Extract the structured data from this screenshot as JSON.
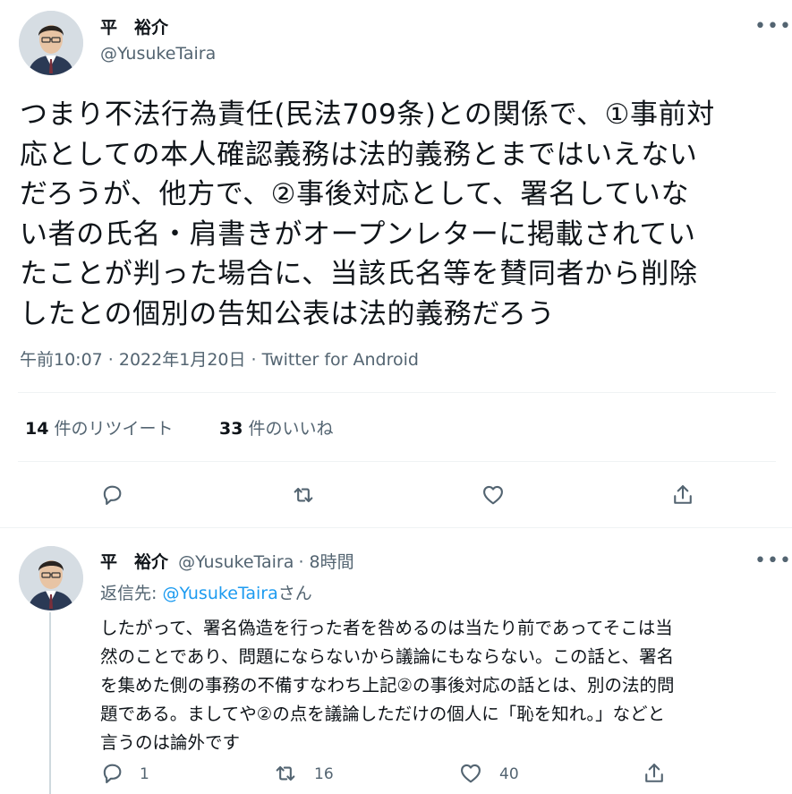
{
  "tweet": {
    "author_name": "平　裕介",
    "author_handle": "@YusukeTaira",
    "text_lines": [
      "つまり不法行為責任(民法709条)との関係で、①事前対",
      "応としての本人確認義務は法的義務とまではいえない",
      "だろうが、他方で、②事後対応として、署名していな",
      "い者の氏名・肩書きがオープンレターに掲載されてい",
      "たことが判った場合に、当該氏名等を賛同者から削除",
      "したとの個別の告知公表は法的義務だろう"
    ],
    "timestamp": "午前10:07 · 2022年1月20日 · Twitter for Android",
    "retweet_count": "14",
    "retweet_label": "件のリツイート",
    "like_count": "33",
    "like_label": "件のいいね",
    "more_icon": "more-icon",
    "actions": [
      "reply-icon",
      "retweet-icon",
      "like-icon",
      "share-icon"
    ]
  },
  "reply": {
    "author_name": "平　裕介",
    "author_handle": "@YusukeTaira",
    "time": "· 8時間",
    "reply_to_prefix": "返信先: ",
    "reply_to_handle": "@YusukeTaira",
    "reply_to_suffix": "さん",
    "text_lines": [
      "したがって、署名偽造を行った者を咎めるのは当たり前であってそこは当",
      "然のことであり、問題にならないから議論にもならない。この話と、署名",
      "を集めた側の事務の不備すなわち上記②の事後対応の話とは、別の法的問",
      "題である。ましてや②の点を議論しただけの個人に「恥を知れ。」などと",
      "言うのは論外です"
    ],
    "reply_count": "1",
    "retweet_count": "16",
    "like_count": "40"
  },
  "colors": {
    "text": "#0f1419",
    "secondary": "#536471",
    "link": "#1d9bf0",
    "divider": "#eff3f4"
  }
}
